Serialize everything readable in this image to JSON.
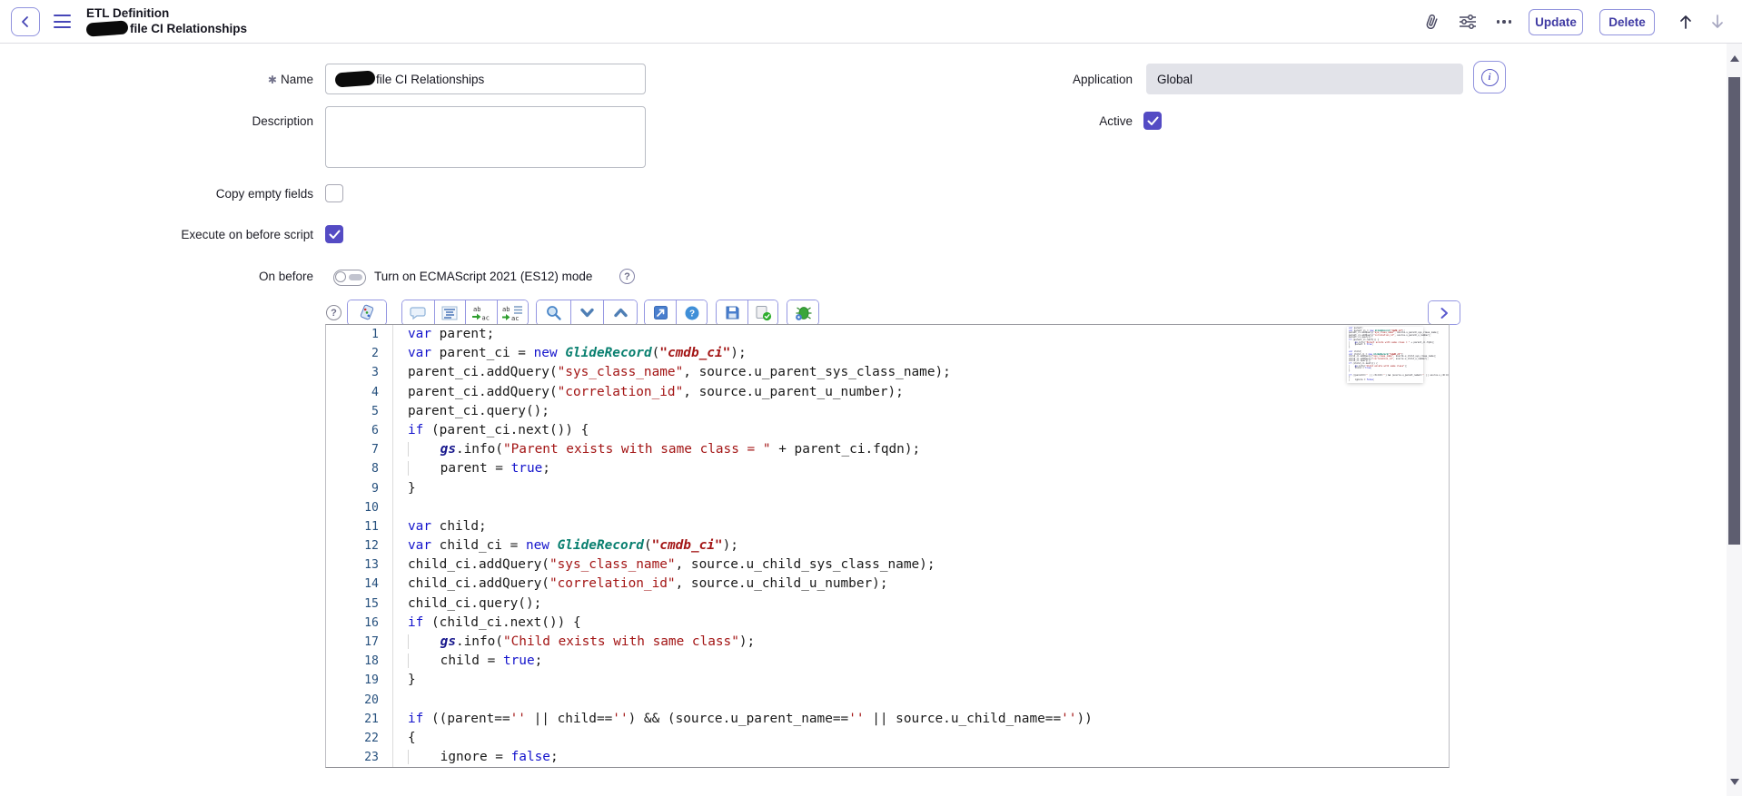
{
  "header": {
    "title": "ETL Definition",
    "subtitle_visible": "file CI Relationships",
    "subtitle_redacted": true,
    "update_label": "Update",
    "delete_label": "Delete"
  },
  "glyphs": {
    "question": "?",
    "info": "i",
    "asterisk": "✱",
    "ab": "ab",
    "ac": "ac"
  },
  "form": {
    "name": {
      "label": "Name",
      "required": true,
      "value_visible": "file CI Relationships",
      "value_redacted": true
    },
    "description": {
      "label": "Description",
      "value": ""
    },
    "application": {
      "label": "Application",
      "value": "Global"
    },
    "active": {
      "label": "Active",
      "checked": true
    },
    "copy_empty_fields": {
      "label": "Copy empty fields",
      "checked": false
    },
    "execute_on_before_script": {
      "label": "Execute on before script",
      "checked": true
    },
    "on_before": {
      "label": "On before",
      "toggle_label": "Turn on ECMAScript 2021 (ES12) mode",
      "toggle_on": false
    }
  },
  "editor": {
    "toolbar_icons": [
      "help-icon",
      "syntax-editor-icon",
      "comment-icon",
      "format-code-icon",
      "replace-icon",
      "replace-all-icon",
      "search-icon",
      "find-next-icon",
      "find-previous-icon",
      "open-new-window-icon",
      "editor-help-icon",
      "save-icon",
      "syntax-check-icon",
      "script-debugger-icon",
      "expand-icon"
    ],
    "code_lines": [
      "var parent;",
      "var parent_ci = new GlideRecord(\"cmdb_ci\");",
      "parent_ci.addQuery(\"sys_class_name\", source.u_parent_sys_class_name);",
      "parent_ci.addQuery(\"correlation_id\", source.u_parent_u_number);",
      "parent_ci.query();",
      "if (parent_ci.next()) {",
      "    gs.info(\"Parent exists with same class = \" + parent_ci.fqdn);",
      "    parent = true;",
      "}",
      "",
      "var child;",
      "var child_ci = new GlideRecord(\"cmdb_ci\");",
      "child_ci.addQuery(\"sys_class_name\", source.u_child_sys_class_name);",
      "child_ci.addQuery(\"correlation_id\", source.u_child_u_number);",
      "child_ci.query();",
      "if (child_ci.next()) {",
      "    gs.info(\"Child exists with same class\");",
      "    child = true;",
      "}",
      "",
      "if ((parent=='' || child=='') && (source.u_parent_name=='' || source.u_child_name==''))",
      "{",
      "    ignore = false;"
    ]
  },
  "colors": {
    "accent": "#4540a8",
    "checkbox_checked": "#544bc4",
    "keyword": "#1414cc",
    "string": "#a31515",
    "glide_class": "#087f6f",
    "line_number": "#27517e"
  }
}
